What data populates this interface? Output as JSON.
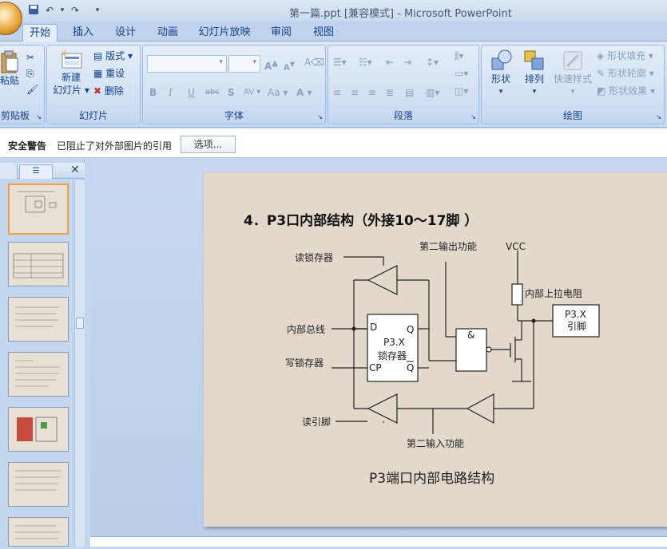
{
  "window": {
    "title": "第一篇.ppt [兼容模式] - Microsoft PowerPoint"
  },
  "tabs": [
    "开始",
    "插入",
    "设计",
    "动画",
    "幻灯片放映",
    "审阅",
    "视图"
  ],
  "ribbon": {
    "clipboard": {
      "paste": "粘贴",
      "label": "剪贴板"
    },
    "slides": {
      "new_slide": "新建\n幻灯片",
      "new_slide_line1": "新建",
      "new_slide_line2": "幻灯片",
      "layout": "版式",
      "reset": "重设",
      "delete": "删除",
      "label": "幻灯片"
    },
    "font": {
      "label": "字体",
      "font_name": "",
      "font_size": ""
    },
    "paragraph": {
      "label": "段落"
    },
    "drawing": {
      "shapes": "形状",
      "arrange": "排列",
      "quick_styles": "快速样式",
      "shape_fill": "形状填充",
      "shape_outline": "形状轮廓",
      "shape_effects": "形状效果",
      "label": "绘图"
    }
  },
  "security": {
    "title": "安全警告",
    "message": "已阻止了对外部图片的引用",
    "options": "选项..."
  },
  "slide": {
    "title": "4．P3口内部结构（外接10～17脚 ）",
    "caption": "P3端口内部电路结构",
    "labels": {
      "read_latch": "读锁存器",
      "internal_bus": "内部总线",
      "write_latch": "写锁存器",
      "read_pin": "读引脚",
      "second_output": "第二输出功能",
      "second_input": "第二输入功能",
      "vcc": "VCC",
      "pullup": "内部上拉电阻",
      "latch_name": "P3.X",
      "latch_sub": "锁存器",
      "pin_name": "P3.X",
      "pin_sub": "引脚",
      "d": "D",
      "q": "Q",
      "cp": "CP",
      "qbar": "Q",
      "and": "&"
    }
  },
  "thumbnails": 7
}
